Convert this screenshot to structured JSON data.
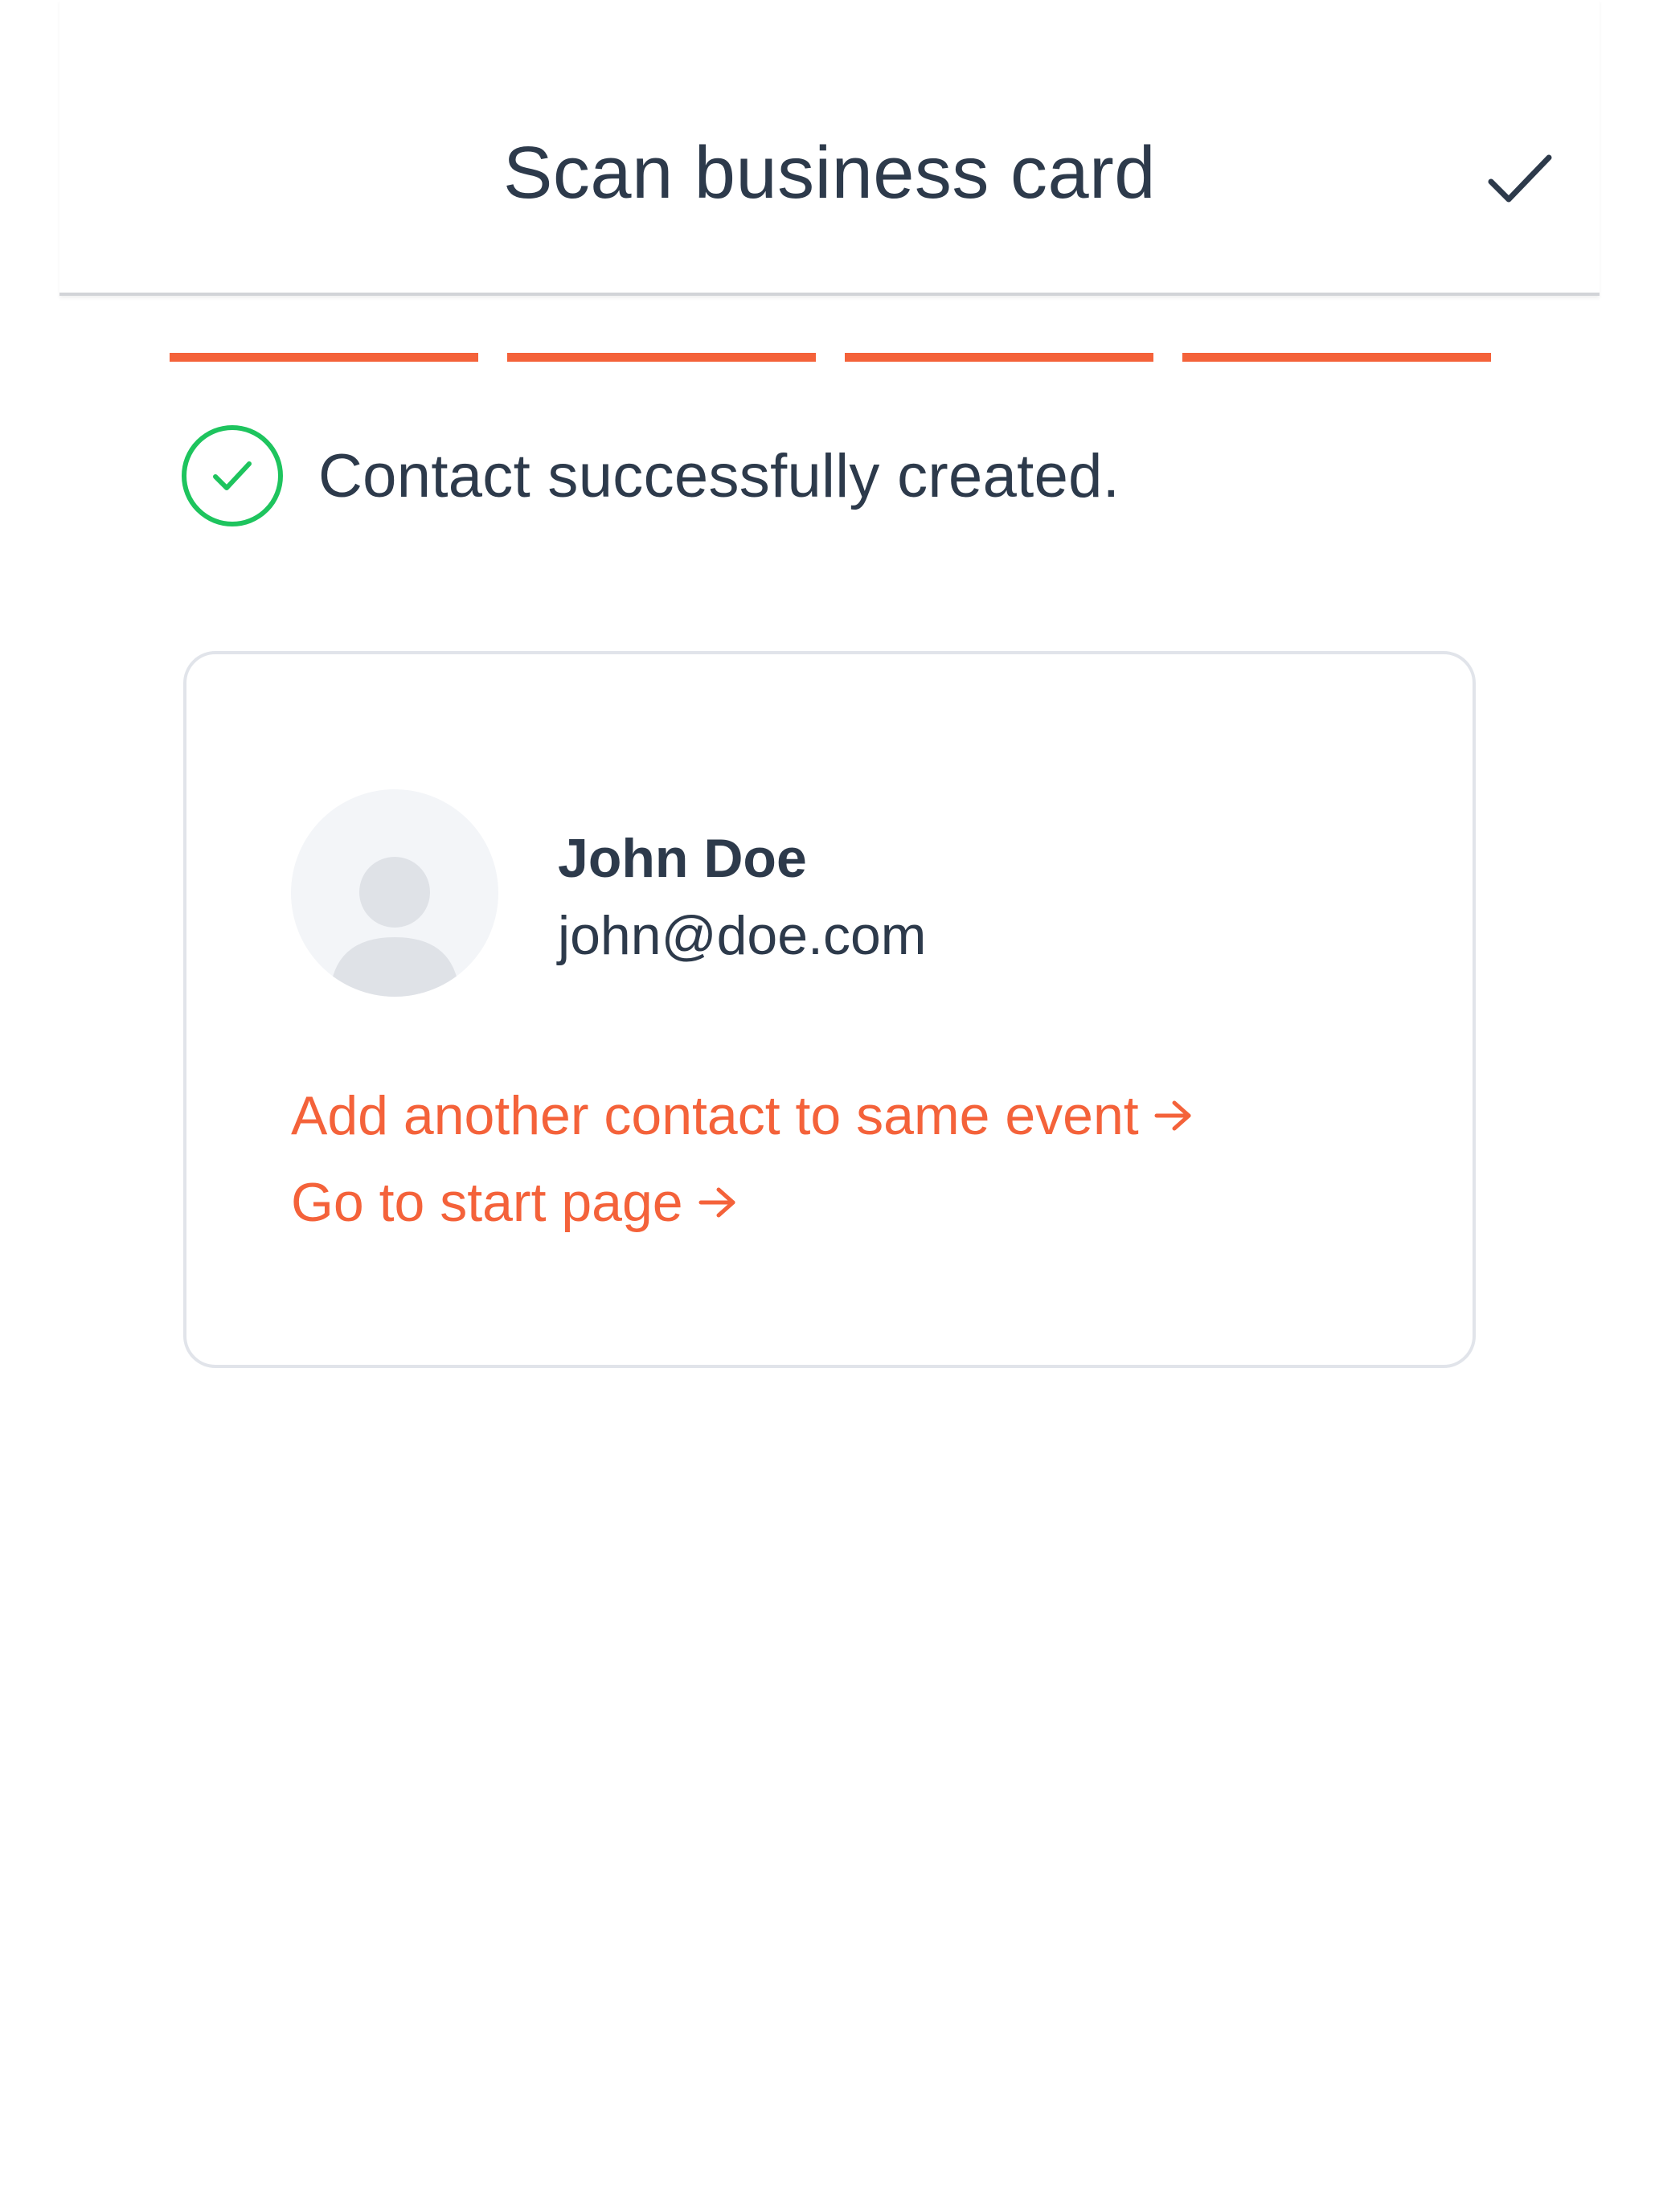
{
  "header": {
    "title": "Scan business card",
    "confirm_icon": "check-icon"
  },
  "progress": {
    "total_steps": 4,
    "completed_steps": 4,
    "color": "#f4623a"
  },
  "status": {
    "icon": "check-circle-icon",
    "icon_color": "#1ec45e",
    "message": "Contact successfully created."
  },
  "contact": {
    "avatar_icon": "person-placeholder-icon",
    "name": "John Doe",
    "email": "john@doe.com"
  },
  "actions": {
    "add_another_label": "Add another contact to same event",
    "go_start_label": "Go to start page",
    "arrow_icon": "arrow-right-icon",
    "link_color": "#f4623a"
  }
}
